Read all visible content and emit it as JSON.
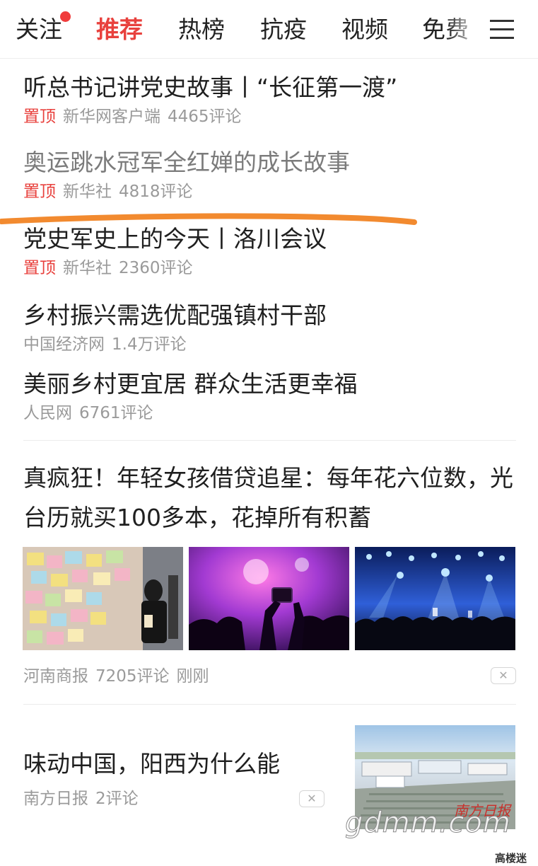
{
  "tabs": [
    "关注",
    "推荐",
    "热榜",
    "抗疫",
    "视频",
    "免费"
  ],
  "active_tab": "推荐",
  "menu_icon": "hamburger-menu-icon",
  "accent_color": "#e8413d",
  "pinned_news": [
    {
      "title": "听总书记讲党史故事丨“长征第一渡”",
      "pin": "置顶",
      "source": "新华网客户端",
      "comments": "4465评论",
      "read": false
    },
    {
      "title": "奥运跳水冠军全红婵的成长故事",
      "pin": "置顶",
      "source": "新华社",
      "comments": "4818评论",
      "read": true
    },
    {
      "title": "党史军史上的今天丨洛川会议",
      "pin": "置顶",
      "source": "新华社",
      "comments": "2360评论",
      "read": false
    }
  ],
  "news": [
    {
      "title": "乡村振兴需选优配强镇村干部",
      "source": "中国经济网",
      "comments": "1.4万评论"
    },
    {
      "title": "美丽乡村更宜居 群众生活更幸福",
      "source": "人民网",
      "comments": "6761评论"
    }
  ],
  "feature": {
    "title": "真疯狂！年轻女孩借贷追星：每年花六位数，光台历就买100多本，花掉所有积蓄",
    "source": "河南商报",
    "comments": "7205评论",
    "time": "刚刚",
    "images": [
      "sticky-notes-wall-image",
      "concert-phone-image",
      "concert-crowd-image"
    ]
  },
  "side_item": {
    "title": "味动中国，阳西为什么能",
    "source": "南方日报",
    "comments": "2评论",
    "image": "factory-aerial-image",
    "image_stamp": "南方日报"
  },
  "dismiss_glyph": "✕",
  "watermark": "gdmm.com",
  "corner_logo": "高楼迷"
}
